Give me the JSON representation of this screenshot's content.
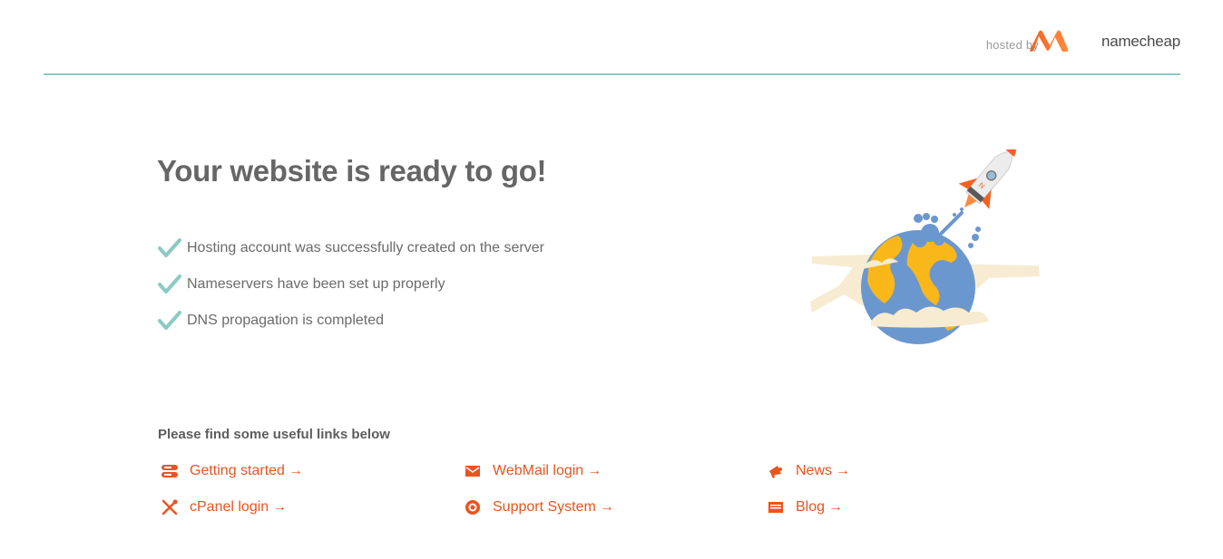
{
  "header": {
    "hosted_by": "hosted by",
    "brand_name": "namecheap",
    "divider_color": "#8ccbc4",
    "brand_color": "#f26322"
  },
  "main": {
    "title": "Your website is ready to go!",
    "checklist": [
      {
        "icon": "check-icon",
        "text": "Hosting account was successfully created on the server"
      },
      {
        "icon": "check-icon",
        "text": "Nameservers have been set up properly"
      },
      {
        "icon": "check-icon",
        "text": "DNS propagation is completed"
      }
    ],
    "check_color": "#8ccbc4"
  },
  "links": {
    "title": "Please find some useful links below",
    "arrow": "→",
    "color": "#e95420",
    "items": [
      {
        "icon": "server-icon",
        "label": "Getting started"
      },
      {
        "icon": "envelope-icon",
        "label": "WebMail login"
      },
      {
        "icon": "megaphone-icon",
        "label": "News"
      },
      {
        "icon": "tools-icon",
        "label": "cPanel login"
      },
      {
        "icon": "lifebuoy-icon",
        "label": "Support System"
      },
      {
        "icon": "blog-icon",
        "label": "Blog"
      }
    ]
  }
}
